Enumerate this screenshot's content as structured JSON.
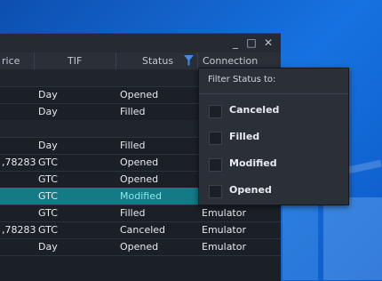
{
  "window": {
    "controls": {
      "minimize": "_",
      "maximize": "□",
      "close": "✕"
    }
  },
  "columns": {
    "price": "rice",
    "tif": "TIF",
    "status": "Status",
    "connection": "Connection na..."
  },
  "rows": [
    {
      "price": "",
      "tif": "",
      "status": "",
      "connection": "",
      "group": true
    },
    {
      "price": "",
      "tif": "Day",
      "status": "Opened",
      "connection": ""
    },
    {
      "price": "",
      "tif": "Day",
      "status": "Filled",
      "connection": ""
    },
    {
      "price": "",
      "tif": "",
      "status": "",
      "connection": "",
      "group": true
    },
    {
      "price": "",
      "tif": "Day",
      "status": "Filled",
      "connection": ""
    },
    {
      "price": ",78283",
      "tif": "GTC",
      "status": "Opened",
      "connection": ""
    },
    {
      "price": "",
      "tif": "GTC",
      "status": "Opened",
      "connection": ""
    },
    {
      "price": "",
      "tif": "GTC",
      "status": "Modified",
      "connection": "",
      "selected": true
    },
    {
      "price": "",
      "tif": "GTC",
      "status": "Filled",
      "connection": "Emulator"
    },
    {
      "price": ",78283",
      "tif": "GTC",
      "status": "Canceled",
      "connection": "Emulator"
    },
    {
      "price": "",
      "tif": "Day",
      "status": "Opened",
      "connection": "Emulator"
    }
  ],
  "filter_popup": {
    "title": "Filter Status to:",
    "options": [
      {
        "label": "Canceled",
        "checked": false
      },
      {
        "label": "Filled",
        "checked": false
      },
      {
        "label": "Modified",
        "checked": false
      },
      {
        "label": "Opened",
        "checked": false
      }
    ]
  },
  "icons": {
    "filter": "filter-icon"
  },
  "colors": {
    "accent": "#137a86",
    "filter_icon": "#3a8fe8"
  }
}
